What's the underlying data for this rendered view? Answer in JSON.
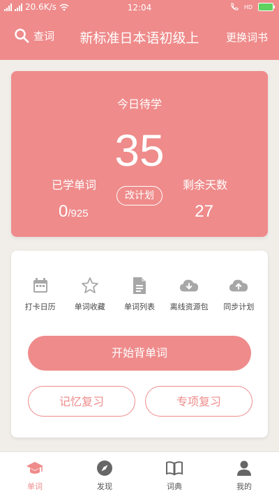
{
  "status_bar": {
    "network_speed": "20.6K/s",
    "time": "12:04",
    "sim_label": "HD"
  },
  "header": {
    "search_label": "查词",
    "title": "新标准日本语初级上",
    "change_book_label": "更换词书"
  },
  "stats": {
    "today_label": "今日待学",
    "today_count": "35",
    "learned_label": "已学单词",
    "learned_count": "0",
    "learned_total": "/925",
    "plan_button_label": "改计划",
    "remaining_label": "剩余天数",
    "remaining_days": "27"
  },
  "quick_actions": [
    {
      "label": "打卡日历",
      "icon": "calendar-icon"
    },
    {
      "label": "单词收藏",
      "icon": "star-icon"
    },
    {
      "label": "单词列表",
      "icon": "document-icon"
    },
    {
      "label": "离线资源包",
      "icon": "cloud-download-icon"
    },
    {
      "label": "同步计划",
      "icon": "cloud-upload-icon"
    }
  ],
  "buttons": {
    "start_label": "开始背单词",
    "memory_review_label": "记忆复习",
    "special_review_label": "专项复习"
  },
  "bottom_nav": [
    {
      "label": "单词",
      "icon": "graduation-cap-icon",
      "active": true
    },
    {
      "label": "发现",
      "icon": "compass-icon",
      "active": false
    },
    {
      "label": "词典",
      "icon": "book-icon",
      "active": false
    },
    {
      "label": "我的",
      "icon": "user-icon",
      "active": false
    }
  ],
  "colors": {
    "accent": "#ef8b8b",
    "background": "#f1eeea",
    "icon_gray": "#a7a7a7"
  }
}
